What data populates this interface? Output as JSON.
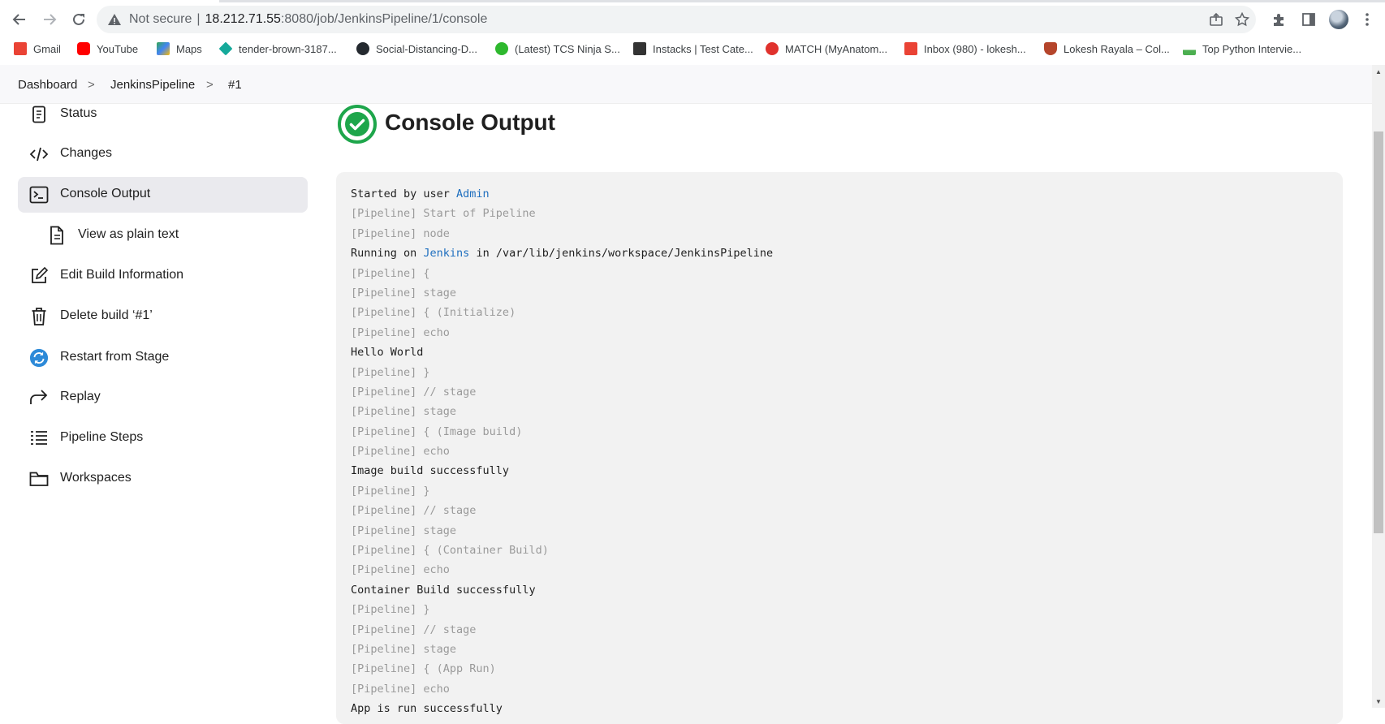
{
  "browser": {
    "url_security": "Not secure",
    "url_host": "18.212.71.55",
    "url_rest": ":8080/job/JenkinsPipeline/1/console"
  },
  "bookmarks": [
    {
      "label": "Gmail",
      "color": "#ea4335"
    },
    {
      "label": "YouTube",
      "color": "#ff0000"
    },
    {
      "label": "Maps",
      "color": "#34a853"
    },
    {
      "label": "tender-brown-3187...",
      "color": "#15a99a"
    },
    {
      "label": "Social-Distancing-D...",
      "color": "#24292f"
    },
    {
      "label": "(Latest) TCS Ninja S...",
      "color": "#2eb82e"
    },
    {
      "label": "Instacks | Test Cate...",
      "color": "#333333"
    },
    {
      "label": "MATCH (MyAnatom...",
      "color": "#e0322d"
    },
    {
      "label": "Inbox (980) - lokesh...",
      "color": "#ea4335"
    },
    {
      "label": "Lokesh Rayala – Col...",
      "color": "#b5452b"
    },
    {
      "label": "Top Python Intervie...",
      "color": "#4caf50"
    }
  ],
  "breadcrumb": {
    "items": [
      "Dashboard",
      "JenkinsPipeline",
      "#1"
    ],
    "separator": ">"
  },
  "sidebar": {
    "items": [
      {
        "label": "Status",
        "icon": "document-icon"
      },
      {
        "label": "Changes",
        "icon": "code-icon"
      },
      {
        "label": "Console Output",
        "icon": "terminal-icon",
        "active": true
      },
      {
        "label": "View as plain text",
        "icon": "file-text-icon"
      },
      {
        "label": "Edit Build Information",
        "icon": "edit-icon"
      },
      {
        "label": "Delete build ‘#1’",
        "icon": "trash-icon"
      },
      {
        "label": "Restart from Stage",
        "icon": "restart-icon"
      },
      {
        "label": "Replay",
        "icon": "replay-icon"
      },
      {
        "label": "Pipeline Steps",
        "icon": "list-icon"
      },
      {
        "label": "Workspaces",
        "icon": "folder-icon"
      }
    ]
  },
  "main": {
    "title": "Console Output",
    "status_color": "#1ea64b",
    "started_prefix": "Started by user ",
    "started_user": "Admin",
    "running_prefix": "Running on ",
    "running_node": "Jenkins",
    "running_suffix": " in /var/lib/jenkins/workspace/JenkinsPipeline",
    "log": [
      {
        "text": "[Pipeline] Start of Pipeline",
        "dim": true
      },
      {
        "text": "[Pipeline] node",
        "dim": true
      },
      {
        "text": "[Pipeline] {",
        "dim": true
      },
      {
        "text": "[Pipeline] stage",
        "dim": true
      },
      {
        "text": "[Pipeline] { (Initialize)",
        "dim": true
      },
      {
        "text": "[Pipeline] echo",
        "dim": true
      },
      {
        "text": "Hello World",
        "dim": false
      },
      {
        "text": "[Pipeline] }",
        "dim": true
      },
      {
        "text": "[Pipeline] // stage",
        "dim": true
      },
      {
        "text": "[Pipeline] stage",
        "dim": true
      },
      {
        "text": "[Pipeline] { (Image build)",
        "dim": true
      },
      {
        "text": "[Pipeline] echo",
        "dim": true
      },
      {
        "text": "Image build successfully",
        "dim": false
      },
      {
        "text": "[Pipeline] }",
        "dim": true
      },
      {
        "text": "[Pipeline] // stage",
        "dim": true
      },
      {
        "text": "[Pipeline] stage",
        "dim": true
      },
      {
        "text": "[Pipeline] { (Container Build)",
        "dim": true
      },
      {
        "text": "[Pipeline] echo",
        "dim": true
      },
      {
        "text": "Container Build successfully",
        "dim": false
      },
      {
        "text": "[Pipeline] }",
        "dim": true
      },
      {
        "text": "[Pipeline] // stage",
        "dim": true
      },
      {
        "text": "[Pipeline] stage",
        "dim": true
      },
      {
        "text": "[Pipeline] { (App Run)",
        "dim": true
      },
      {
        "text": "[Pipeline] echo",
        "dim": true
      },
      {
        "text": "App is run successfully",
        "dim": false
      }
    ]
  }
}
